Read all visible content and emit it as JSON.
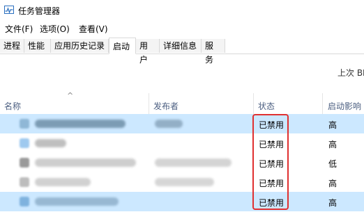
{
  "window": {
    "title": "任务管理器"
  },
  "menu": [
    {
      "label": "文件(F)"
    },
    {
      "label": "选项(O)"
    },
    {
      "label": "查看(V)"
    }
  ],
  "tabs": [
    {
      "label": "进程"
    },
    {
      "label": "性能"
    },
    {
      "label": "应用历史记录"
    },
    {
      "label": "启动"
    },
    {
      "label": "用户"
    },
    {
      "label": "详细信息"
    },
    {
      "label": "服务"
    }
  ],
  "active_tab": "启动",
  "boot_time_label": "上次 BI",
  "columns": {
    "name": "名称",
    "publisher": "发布者",
    "status": "状态",
    "impact": "启动影响"
  },
  "rows": [
    {
      "status": "已禁用",
      "impact": "高",
      "selected": true
    },
    {
      "status": "已禁用",
      "impact": "高",
      "selected": false
    },
    {
      "status": "已禁用",
      "impact": "低",
      "selected": false
    },
    {
      "status": "已禁用",
      "impact": "高",
      "selected": false
    },
    {
      "status": "已禁用",
      "impact": "高",
      "selected": true
    }
  ],
  "colors": {
    "selected_row": "#cce8ff",
    "highlight_box": "#e03030",
    "header_text": "#4d6082"
  }
}
